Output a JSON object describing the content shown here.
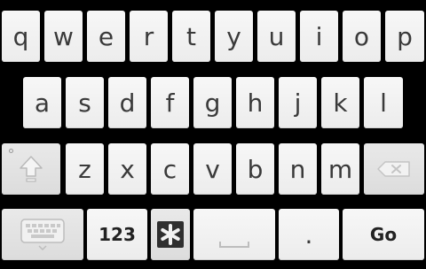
{
  "keyboard": {
    "row1": [
      "q",
      "w",
      "e",
      "r",
      "t",
      "y",
      "u",
      "i",
      "o",
      "p"
    ],
    "row2": [
      "a",
      "s",
      "d",
      "f",
      "g",
      "h",
      "j",
      "k",
      "l"
    ],
    "row3": [
      "z",
      "x",
      "c",
      "v",
      "b",
      "n",
      "m"
    ],
    "bottom": {
      "numbers_label": "123",
      "period_label": ".",
      "go_label": "Go"
    },
    "icons": {
      "shift": "shift-arrow-icon",
      "delete": "backspace-icon",
      "keyboard": "keyboard-settings-icon",
      "symbol": "symbol-star-icon",
      "space": "space-bar-icon"
    }
  }
}
